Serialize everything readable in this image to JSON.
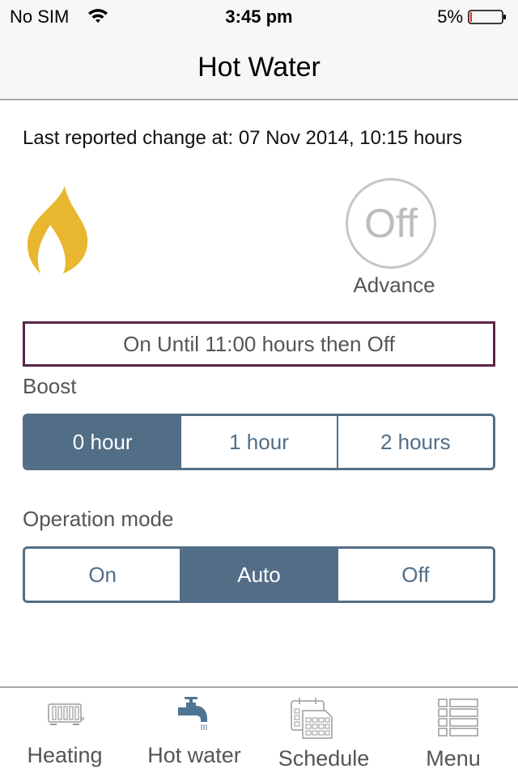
{
  "status_bar": {
    "carrier": "No SIM",
    "time": "3:45 pm",
    "battery_percent": "5%",
    "icons": [
      "wifi-icon",
      "battery-icon"
    ]
  },
  "nav": {
    "title": "Hot Water"
  },
  "last_change": "Last reported change at: 07 Nov 2014, 10:15 hours",
  "flame_icon": "flame-icon",
  "advance": {
    "button_text": "Off",
    "label": "Advance"
  },
  "schedule_status": "On Until 11:00 hours then Off",
  "boost": {
    "label": "Boost",
    "options": [
      "0 hour",
      "1 hour",
      "2 hours"
    ],
    "selected": "0 hour"
  },
  "operation_mode": {
    "label": "Operation mode",
    "options": [
      "On",
      "Auto",
      "Off"
    ],
    "selected": "Auto"
  },
  "tab_bar": {
    "items": [
      {
        "label": "Heating",
        "icon": "radiator-icon"
      },
      {
        "label": "Hot water",
        "icon": "tap-icon"
      },
      {
        "label": "Schedule",
        "icon": "calendar-icon"
      },
      {
        "label": "Menu",
        "icon": "list-icon"
      }
    ],
    "active": "Hot water"
  },
  "colors": {
    "accent": "#526e86",
    "flame": "#e9b62f",
    "status_border": "#5a2548",
    "battery_low": "#e0302a"
  }
}
